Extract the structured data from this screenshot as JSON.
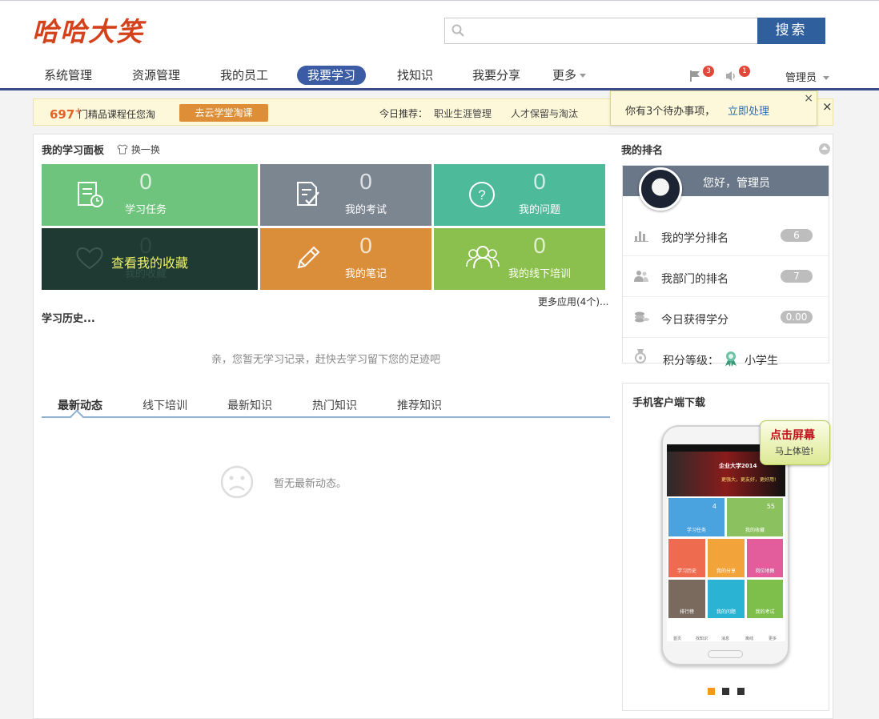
{
  "header": {
    "logo": "哈哈大笑",
    "search": {
      "placeholder": "",
      "value": "",
      "button": "搜索"
    }
  },
  "nav": {
    "items": [
      "系统管理",
      "资源管理",
      "我的员工",
      "我要学习",
      "找知识",
      "我要分享",
      "更多"
    ],
    "active": "我要学习",
    "flag_badge": "3",
    "sound_badge": "1",
    "user": "管理员"
  },
  "promo": {
    "count": "697",
    "plus": "+",
    "text": "门精品课程任您淘",
    "button": "去云学堂淘课",
    "rec_label": "今日推荐：",
    "rec_items": [
      "职业生涯管理",
      "人才保留与淘汰"
    ],
    "close": "×"
  },
  "todo": {
    "text": "你有3个待办事项，",
    "link": "立即处理",
    "close": "×"
  },
  "panel": {
    "title": "我的学习面板",
    "switch": "换一换",
    "tiles": [
      {
        "num": "0",
        "label": "学习任务",
        "color": "#6fc47d",
        "icon": "task-icon"
      },
      {
        "num": "0",
        "label": "我的考试",
        "color": "#7c8691",
        "icon": "exam-icon"
      },
      {
        "num": "0",
        "label": "我的问题",
        "color": "#4dba9a",
        "icon": "question-icon"
      },
      {
        "num": "0",
        "label": "我的收藏",
        "hover": "查看我的收藏",
        "color": "#1e3a32",
        "icon": "heart-icon"
      },
      {
        "num": "0",
        "label": "我的笔记",
        "color": "#db8e3a",
        "icon": "pencil-icon"
      },
      {
        "num": "0",
        "label": "我的线下培训",
        "color": "#8bbf4e",
        "icon": "group-icon"
      }
    ],
    "more_apps": "更多应用(4个)..."
  },
  "history": {
    "title": "学习历史...",
    "empty": "亲，您暂无学习记录，赶快去学习留下您的足迹吧"
  },
  "feed": {
    "tabs": [
      "最新动态",
      "线下培训",
      "最新知识",
      "热门知识",
      "推荐知识"
    ],
    "active": "最新动态",
    "empty": "暂无最新动态。"
  },
  "ranking": {
    "title": "我的排名",
    "greeting": "您好，管理员",
    "rows": [
      {
        "label": "我的学分排名",
        "value": "6",
        "icon": "bar-chart-icon"
      },
      {
        "label": "我部门的排名",
        "value": "7",
        "icon": "people-icon"
      },
      {
        "label": "今日获得学分",
        "value": "0.00",
        "icon": "coins-icon"
      }
    ],
    "level_label": "积分等级：",
    "level_value": "小学生"
  },
  "mobile": {
    "title": "手机客户端下载",
    "bubble_line1": "点击屏幕",
    "bubble_line2": "马上体验!",
    "banner_title": "企业大学2014",
    "banner_sub": "更强大，更友好，更好用!",
    "tiles": [
      {
        "label": "学习任务",
        "num": "4",
        "color": "#4aa3df"
      },
      {
        "label": "我的收藏",
        "num": "55",
        "color": "#8cc15f"
      },
      {
        "label": "学习历史",
        "num": "",
        "color": "#ef6b4f"
      },
      {
        "label": "我的分享",
        "num": "",
        "color": "#f2a33a"
      },
      {
        "label": "岗位地图",
        "num": "",
        "color": "#e35d9c"
      },
      {
        "label": "排行榜",
        "num": "",
        "color": "#7a6a5d"
      },
      {
        "label": "我的问题",
        "num": "",
        "color": "#2ab3d3"
      },
      {
        "label": "我的考试",
        "num": "",
        "color": "#7dbf4a"
      }
    ],
    "bottom_nav": [
      "首页",
      "找知识",
      "消息",
      "离线",
      "更多"
    ],
    "dot_colors": [
      "#f39a1e",
      "#333333",
      "#333333"
    ]
  }
}
